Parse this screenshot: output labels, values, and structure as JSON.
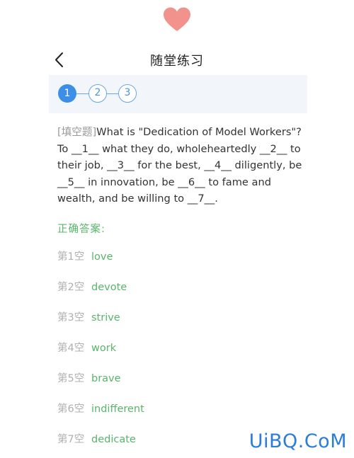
{
  "colors": {
    "heart": "#f2928d",
    "accent_blue": "#3d8ee6",
    "answer_green": "#58b56a",
    "step_bar_bg": "#f2f5f9",
    "watermark": "#2b7dd6"
  },
  "icons": {
    "top": "heart-icon",
    "back": "chevron-left-icon"
  },
  "header": {
    "title": "随堂练习"
  },
  "steps": [
    {
      "label": "1",
      "active": true
    },
    {
      "label": "2",
      "active": false
    },
    {
      "label": "3",
      "active": false
    }
  ],
  "question": {
    "tag": "[填空题]",
    "text": "What is \"Dedication of Model Workers\"? To __1__ what they do, wholeheartedly __2__ to their job, __3__ for the best, __4__ diligently, be __5__ in innovation, be __6__ to fame and wealth, and be willing to __7__."
  },
  "answers": {
    "title": "正确答案:",
    "items": [
      {
        "label": "第1空",
        "value": "love"
      },
      {
        "label": "第2空",
        "value": "devote"
      },
      {
        "label": "第3空",
        "value": "strive"
      },
      {
        "label": "第4空",
        "value": "work"
      },
      {
        "label": "第5空",
        "value": "brave"
      },
      {
        "label": "第6空",
        "value": "indifferent"
      },
      {
        "label": "第7空",
        "value": "dedicate"
      }
    ]
  },
  "watermark": "UiBQ.CoM"
}
